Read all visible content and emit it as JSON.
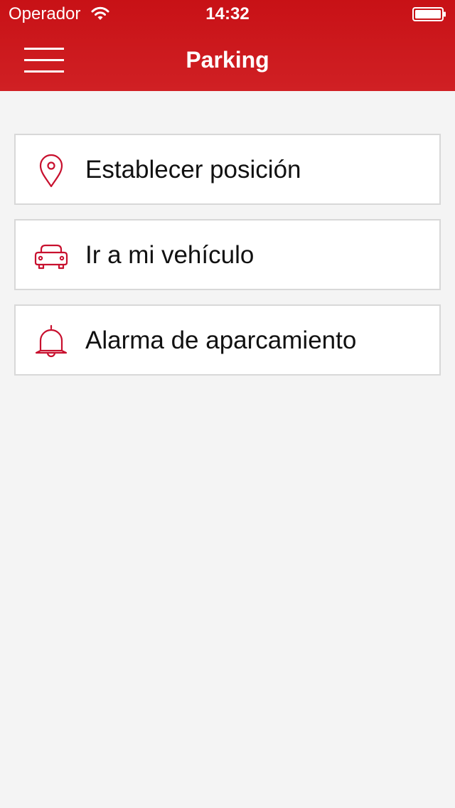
{
  "status_bar": {
    "carrier": "Operador",
    "time": "14:32"
  },
  "nav_bar": {
    "title": "Parking"
  },
  "menu": {
    "items": [
      {
        "label": "Establecer posición",
        "icon": "map-pin-icon"
      },
      {
        "label": "Ir a mi vehículo",
        "icon": "car-icon"
      },
      {
        "label": "Alarma de aparcamiento",
        "icon": "bell-icon"
      }
    ]
  },
  "colors": {
    "brand_red": "#c81116",
    "icon_red": "#c8102e",
    "background": "#f4f4f4",
    "card_border": "#d8d8d8",
    "text": "#111111"
  }
}
